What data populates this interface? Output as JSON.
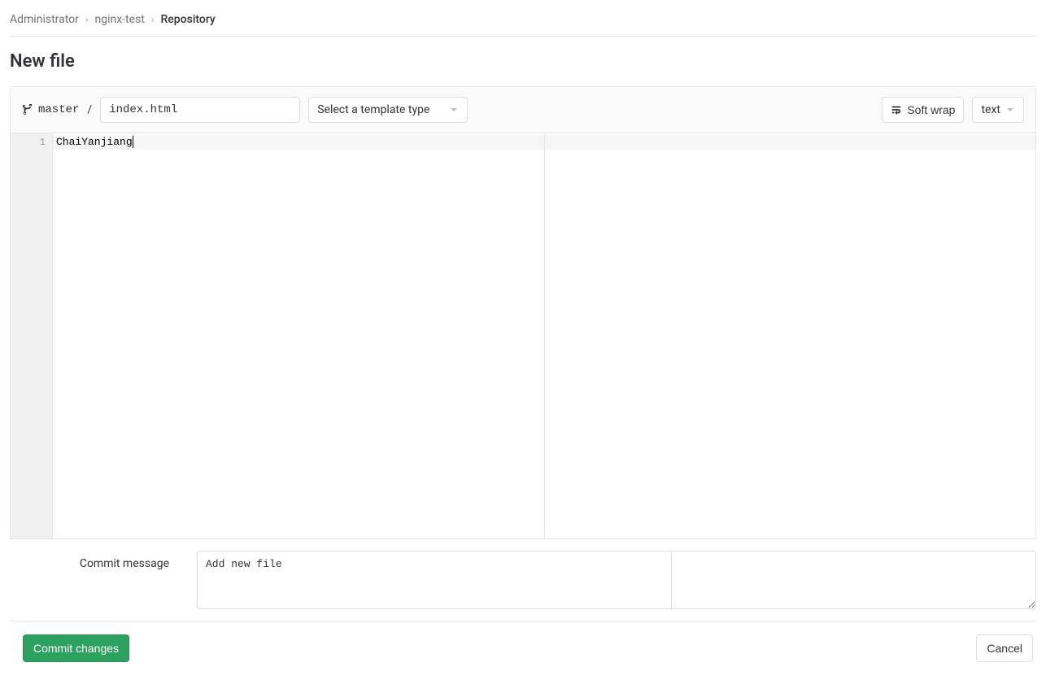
{
  "breadcrumb": {
    "items": [
      "Administrator",
      "nginx-test",
      "Repository"
    ]
  },
  "page": {
    "title": "New file"
  },
  "editor": {
    "branch": "master",
    "path_sep": "/",
    "filename": "index.html",
    "template_placeholder": "Select a template type",
    "softwrap_label": "Soft wrap",
    "filetype_label": "text",
    "line_numbers": [
      "1"
    ],
    "code_content": "ChaiYanjiang"
  },
  "commit": {
    "label": "Commit message",
    "message": "Add new file"
  },
  "actions": {
    "commit": "Commit changes",
    "cancel": "Cancel"
  }
}
